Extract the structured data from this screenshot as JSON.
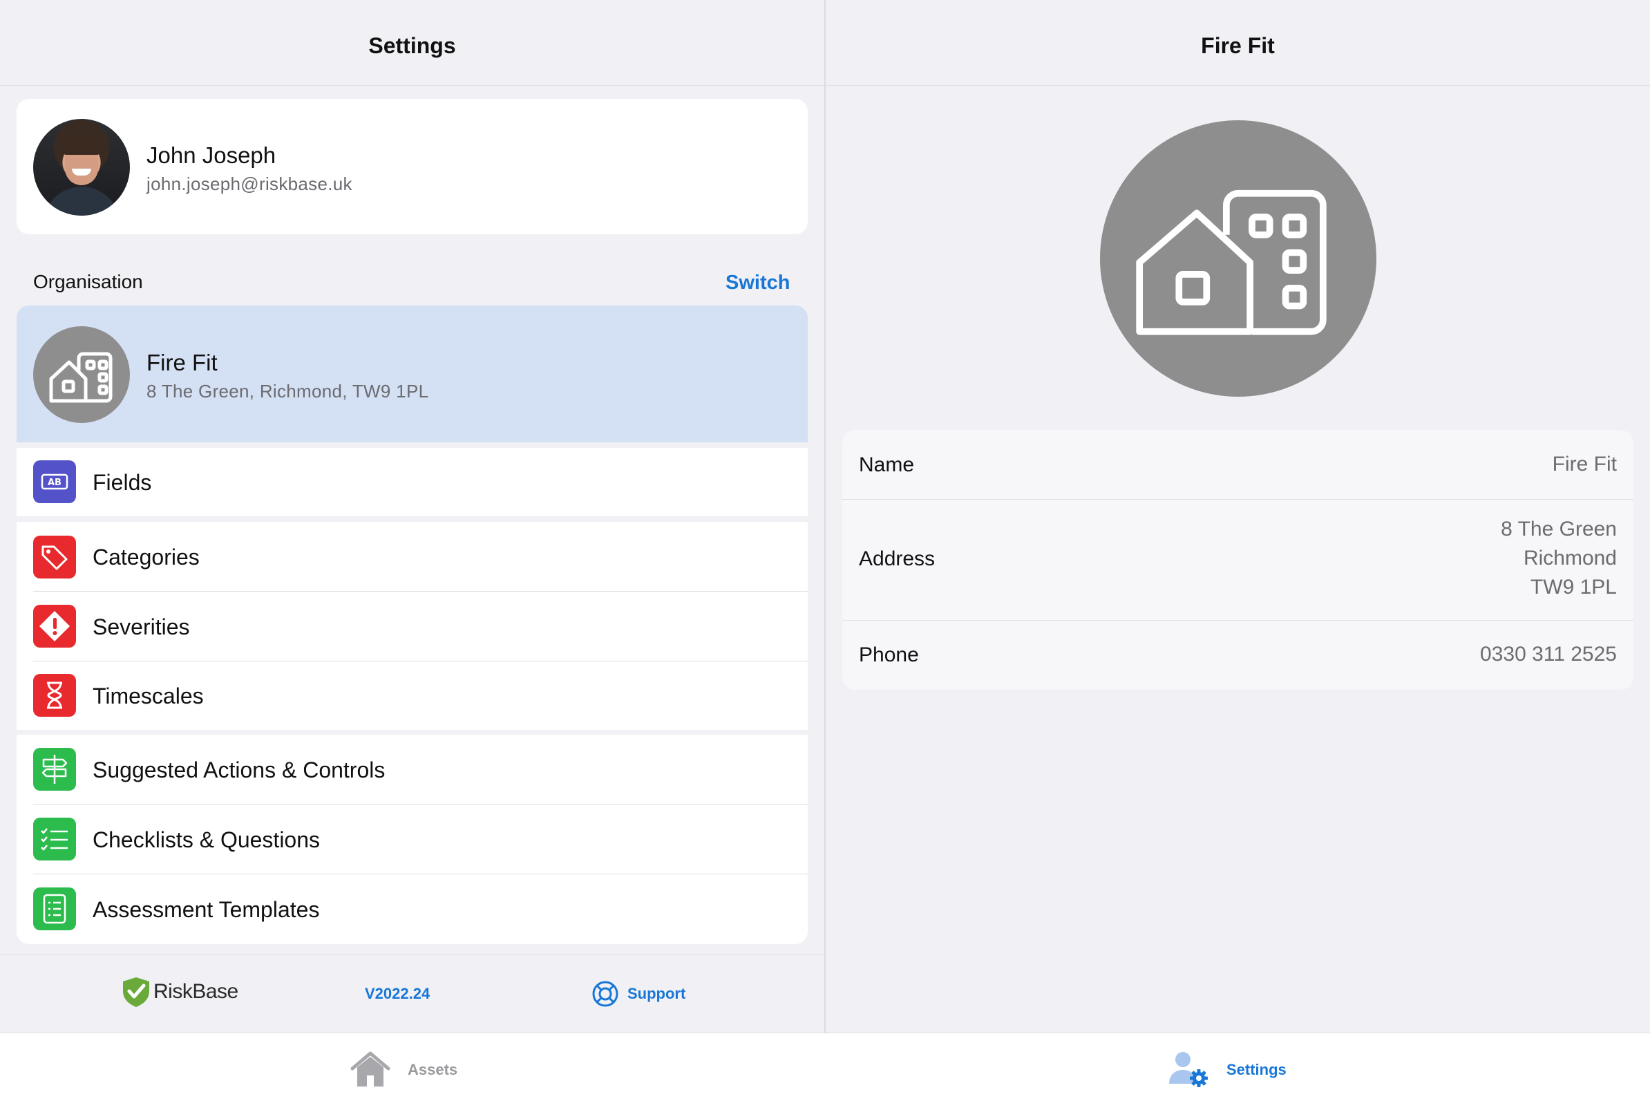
{
  "left": {
    "title": "Settings",
    "profile": {
      "name": "John Joseph",
      "email": "john.joseph@riskbase.uk"
    },
    "organisation": {
      "section_label": "Organisation",
      "switch_label": "Switch",
      "name": "Fire Fit",
      "address": "8 The Green, Richmond, TW9 1PL"
    },
    "menu": [
      {
        "label": "Fields",
        "icon": "fields-icon",
        "color": "#5452c9"
      },
      {
        "label": "Categories",
        "icon": "tag-icon",
        "color": "#e8292d"
      },
      {
        "label": "Severities",
        "icon": "warning-diamond-icon",
        "color": "#e8292d"
      },
      {
        "label": "Timescales",
        "icon": "hourglass-icon",
        "color": "#e8292d"
      },
      {
        "label": "Suggested Actions & Controls",
        "icon": "signpost-icon",
        "color": "#2bbc4d"
      },
      {
        "label": "Checklists & Questions",
        "icon": "checklist-icon",
        "color": "#2bbc4d"
      },
      {
        "label": "Assessment Templates",
        "icon": "template-icon",
        "color": "#2bbc4d"
      }
    ],
    "footer": {
      "brand": "RiskBase",
      "version": "V2022.24",
      "support_label": "Support"
    }
  },
  "right": {
    "title": "Fire Fit",
    "details": {
      "name_label": "Name",
      "name_value": "Fire Fit",
      "address_label": "Address",
      "address_lines": [
        "8 The Green",
        "Richmond",
        "TW9 1PL"
      ],
      "phone_label": "Phone",
      "phone_value": "0330 311 2525"
    }
  },
  "tabbar": {
    "tabs": [
      {
        "label": "Assets",
        "icon": "home-icon",
        "active": false
      },
      {
        "label": "Settings",
        "icon": "user-gear-icon",
        "active": true
      }
    ]
  },
  "colors": {
    "accent": "#1877d6",
    "selected_row": "#d4e0f3",
    "background": "#f0f0f5"
  }
}
